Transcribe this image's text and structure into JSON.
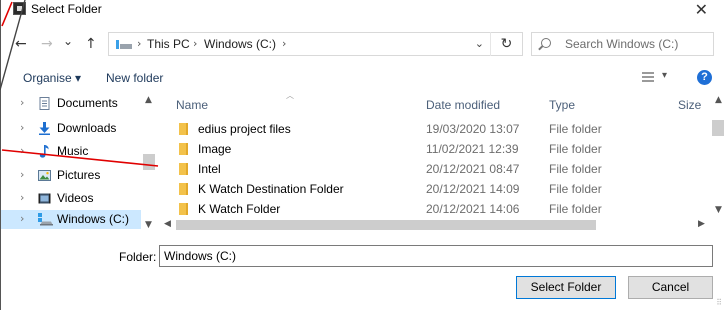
{
  "window": {
    "title": "Select Folder",
    "close_glyph": "✕"
  },
  "nav_buttons": {
    "back_glyph": "←",
    "forward_glyph": "→",
    "recent_glyph": "⌄",
    "up_glyph": "↑"
  },
  "address_bar": {
    "crumbs": [
      "This PC",
      "Windows (C:)"
    ],
    "separator_glyph": "›",
    "dropdown_glyph": "⌄",
    "refresh_glyph": "↻"
  },
  "search": {
    "placeholder": "Search Windows (C:)"
  },
  "toolbar": {
    "organise_label": "Organise ▾",
    "new_folder_label": "New folder",
    "view_dropdown_glyph": "▾",
    "help_glyph": "?"
  },
  "nav_pane": {
    "items": [
      {
        "label": "Documents",
        "icon": "documents-icon"
      },
      {
        "label": "Downloads",
        "icon": "downloads-icon"
      },
      {
        "label": "Music",
        "icon": "music-icon"
      },
      {
        "label": "Pictures",
        "icon": "pictures-icon"
      },
      {
        "label": "Videos",
        "icon": "videos-icon"
      },
      {
        "label": "Windows (C:)",
        "icon": "drive-icon",
        "selected": true
      }
    ],
    "chevron_glyph": "›"
  },
  "file_list": {
    "columns": {
      "name": "Name",
      "date": "Date modified",
      "type": "Type",
      "size": "Size"
    },
    "rows": [
      {
        "name": "edius project files",
        "date": "19/03/2020 13:07",
        "type": "File folder"
      },
      {
        "name": "Image",
        "date": "11/02/2021 12:39",
        "type": "File folder"
      },
      {
        "name": "Intel",
        "date": "20/12/2021 08:47",
        "type": "File folder"
      },
      {
        "name": "K Watch Destination Folder",
        "date": "20/12/2021 14:09",
        "type": "File folder"
      },
      {
        "name": "K Watch Folder",
        "date": "20/12/2021 14:06",
        "type": "File folder"
      }
    ]
  },
  "folder_field": {
    "label": "Folder:",
    "value": "Windows (C:)"
  },
  "buttons": {
    "select_folder": "Select Folder",
    "cancel": "Cancel"
  },
  "colors": {
    "selection": "#cce8ff",
    "accent": "#0078d7",
    "annotation_red": "#e00000"
  }
}
